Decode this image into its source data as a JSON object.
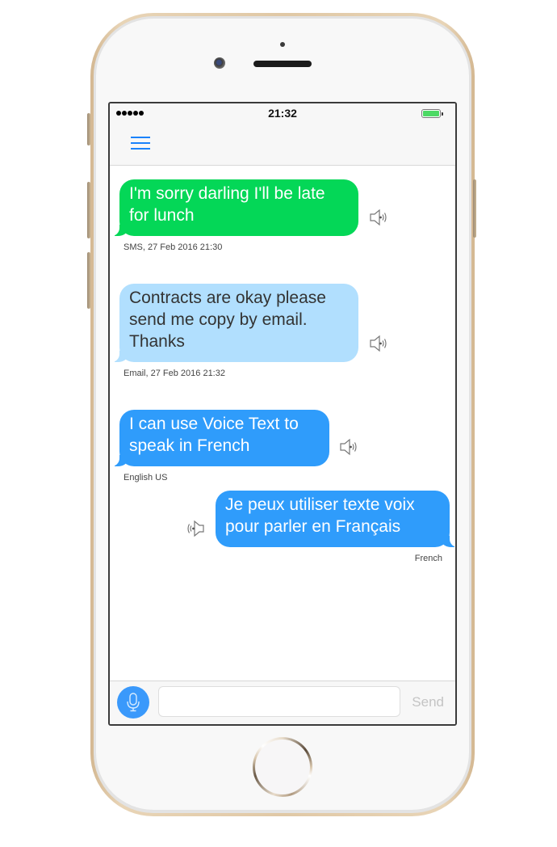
{
  "status_bar": {
    "signal_bars": 5,
    "time": "21:32",
    "battery_level": "full"
  },
  "nav_bar": {
    "menu_icon": "hamburger-menu-icon"
  },
  "messages": [
    {
      "text": "I'm sorry darling I'll be late for lunch",
      "meta": "SMS, 27 Feb 2016 21:30",
      "side": "left",
      "color": "#04d757",
      "icon": "speaker-icon"
    },
    {
      "text": "Contracts are okay please send me copy by email. Thanks",
      "meta": "Email, 27 Feb 2016 21:32",
      "side": "left",
      "color": "#b1dffe",
      "icon": "speaker-icon"
    },
    {
      "text": "I can use Voice Text to speak in French",
      "meta": "English US",
      "side": "left",
      "color": "#2f9cfb",
      "icon": "speaker-icon"
    },
    {
      "text": "Je peux utiliser texte voix pour parler en Français",
      "meta": "French",
      "side": "right",
      "color": "#2f9cfb",
      "icon": "speaker-icon"
    }
  ],
  "input_bar": {
    "mic_icon": "microphone-icon",
    "input_value": "",
    "input_placeholder": "",
    "send_label": "Send"
  },
  "colors": {
    "accent": "#1a82fb",
    "mic_button": "#3a99fb",
    "battery": "#4cd964"
  }
}
